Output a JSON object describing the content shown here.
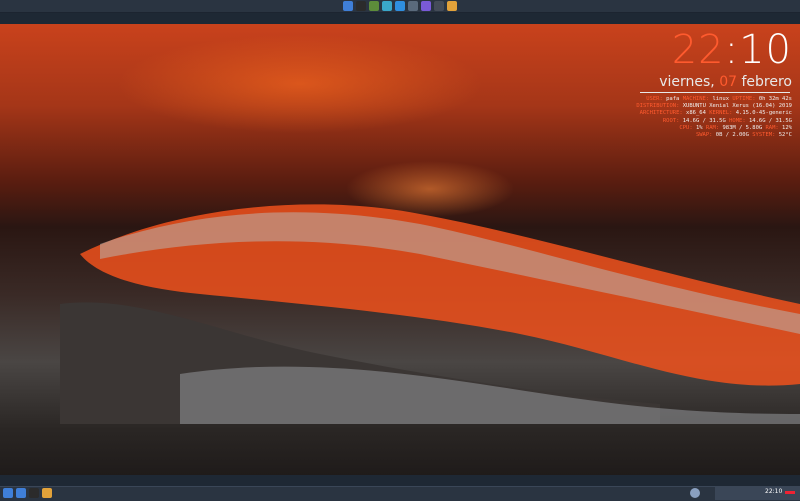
{
  "dock": {
    "icons": [
      {
        "name": "files-icon",
        "color": "#3f7fd8"
      },
      {
        "name": "terminal-icon",
        "color": "#2b2b2b"
      },
      {
        "name": "text-editor-icon",
        "color": "#5d8c3a"
      },
      {
        "name": "store-icon",
        "color": "#3aa7c9"
      },
      {
        "name": "app-store-icon",
        "color": "#2f8fe0"
      },
      {
        "name": "search-icon",
        "color": "#5a6a7c"
      },
      {
        "name": "settings-icon",
        "color": "#7a5ad8"
      },
      {
        "name": "system-monitor-icon",
        "color": "#444c58"
      },
      {
        "name": "chrome-icon",
        "color": "#e2a23a"
      }
    ]
  },
  "clock": {
    "hours": "22",
    "separator": ":",
    "minutes": "10",
    "weekday": "viernes,",
    "day": "07",
    "month": "febrero"
  },
  "sysinfo": {
    "lines": [
      [
        {
          "k": "USER:",
          "v": " pafa "
        },
        {
          "k": "MACHINE:",
          "v": " linux "
        },
        {
          "k": "UPTIME:",
          "v": " 0h 32m 42s"
        }
      ],
      [
        {
          "k": "DISTRIBUTION:",
          "v": " XUBUNTU Xenial Xerus (16.04) 2019"
        }
      ],
      [
        {
          "k": "ARCHITECTURE:",
          "v": " x86_64 "
        },
        {
          "k": "KERNEL:",
          "v": " 4.15.0-45-generic"
        }
      ],
      [
        {
          "k": "ROOT:",
          "v": " 14.6G / 31.5G "
        },
        {
          "k": "HOME:",
          "v": " 14.6G / 31.5G"
        }
      ],
      [
        {
          "k": "CPU:",
          "v": " 1% "
        },
        {
          "k": "RAM:",
          "v": " 983M / 5.80G "
        },
        {
          "k": "RAM:",
          "v": " 12%"
        }
      ],
      [
        {
          "k": "SWAP:",
          "v": " 0B / 2.00G "
        },
        {
          "k": "SYSTEM:",
          "v": " 52°C"
        }
      ]
    ]
  },
  "taskbar": {
    "icons": [
      {
        "name": "app-menu-icon",
        "color": "#3f7fd8"
      },
      {
        "name": "files-icon",
        "color": "#3f7fd8"
      },
      {
        "name": "terminal-icon",
        "color": "#2b2b2b"
      },
      {
        "name": "chrome-icon",
        "color": "#e2a23a"
      }
    ],
    "clock": "22:10"
  }
}
